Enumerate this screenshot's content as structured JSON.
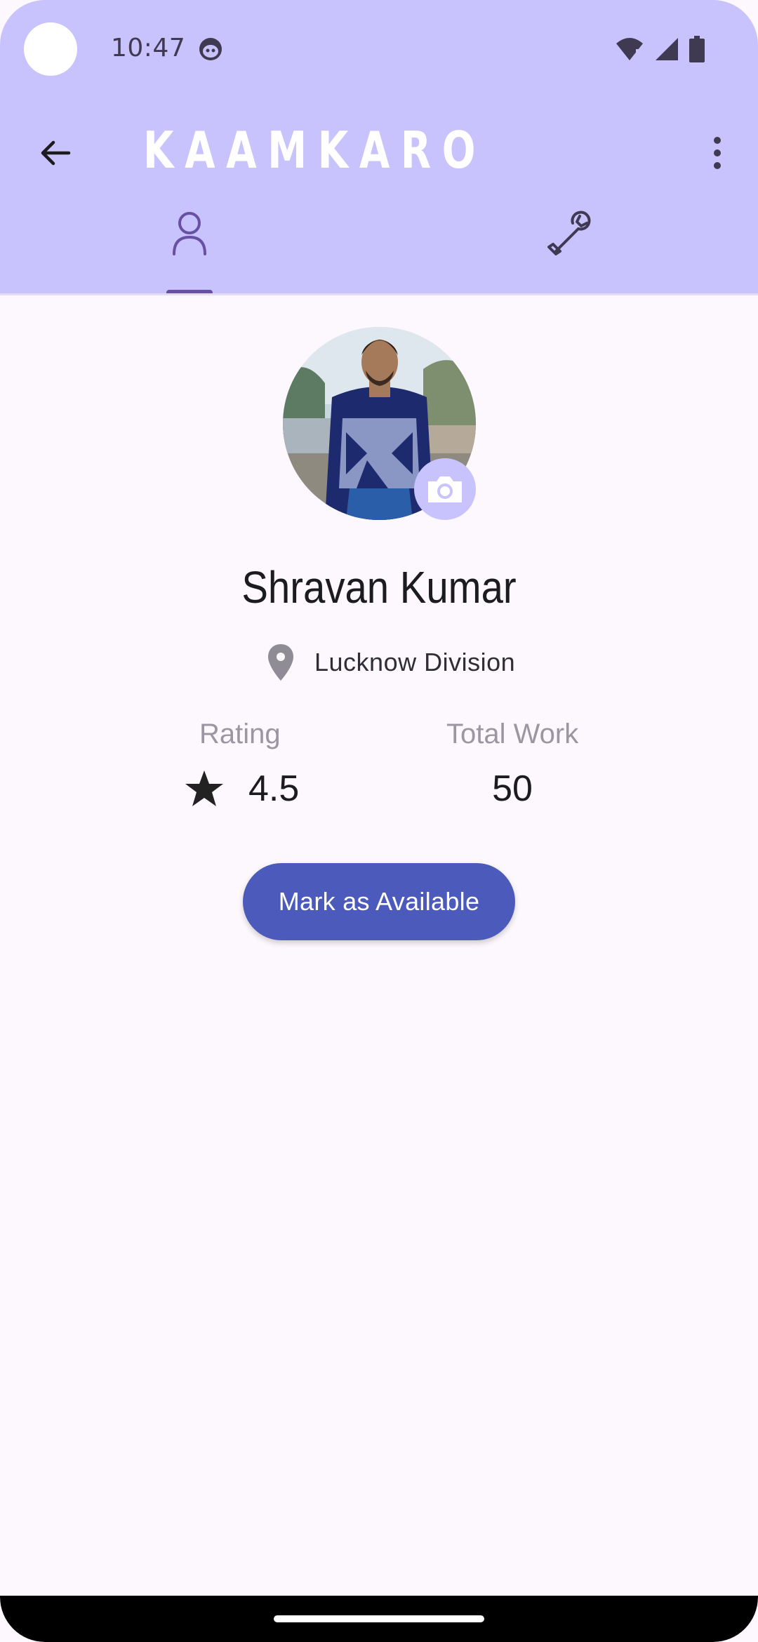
{
  "status_bar": {
    "time": "10:47"
  },
  "toolbar": {
    "title": "KAAMKARO"
  },
  "tabs": [
    {
      "icon": "person-icon",
      "selected": true
    },
    {
      "icon": "wrench-icon",
      "selected": false
    }
  ],
  "profile": {
    "name": "Shravan Kumar",
    "location": "Lucknow Division",
    "rating_label": "Rating",
    "rating_value": "4.5",
    "total_work_label": "Total Work",
    "total_work_value": "50",
    "available_button": "Mark as Available"
  },
  "colors": {
    "header": "#c9c3fd",
    "accent": "#6850a4",
    "button": "#4c5bbb",
    "background": "#fdf8fd"
  }
}
